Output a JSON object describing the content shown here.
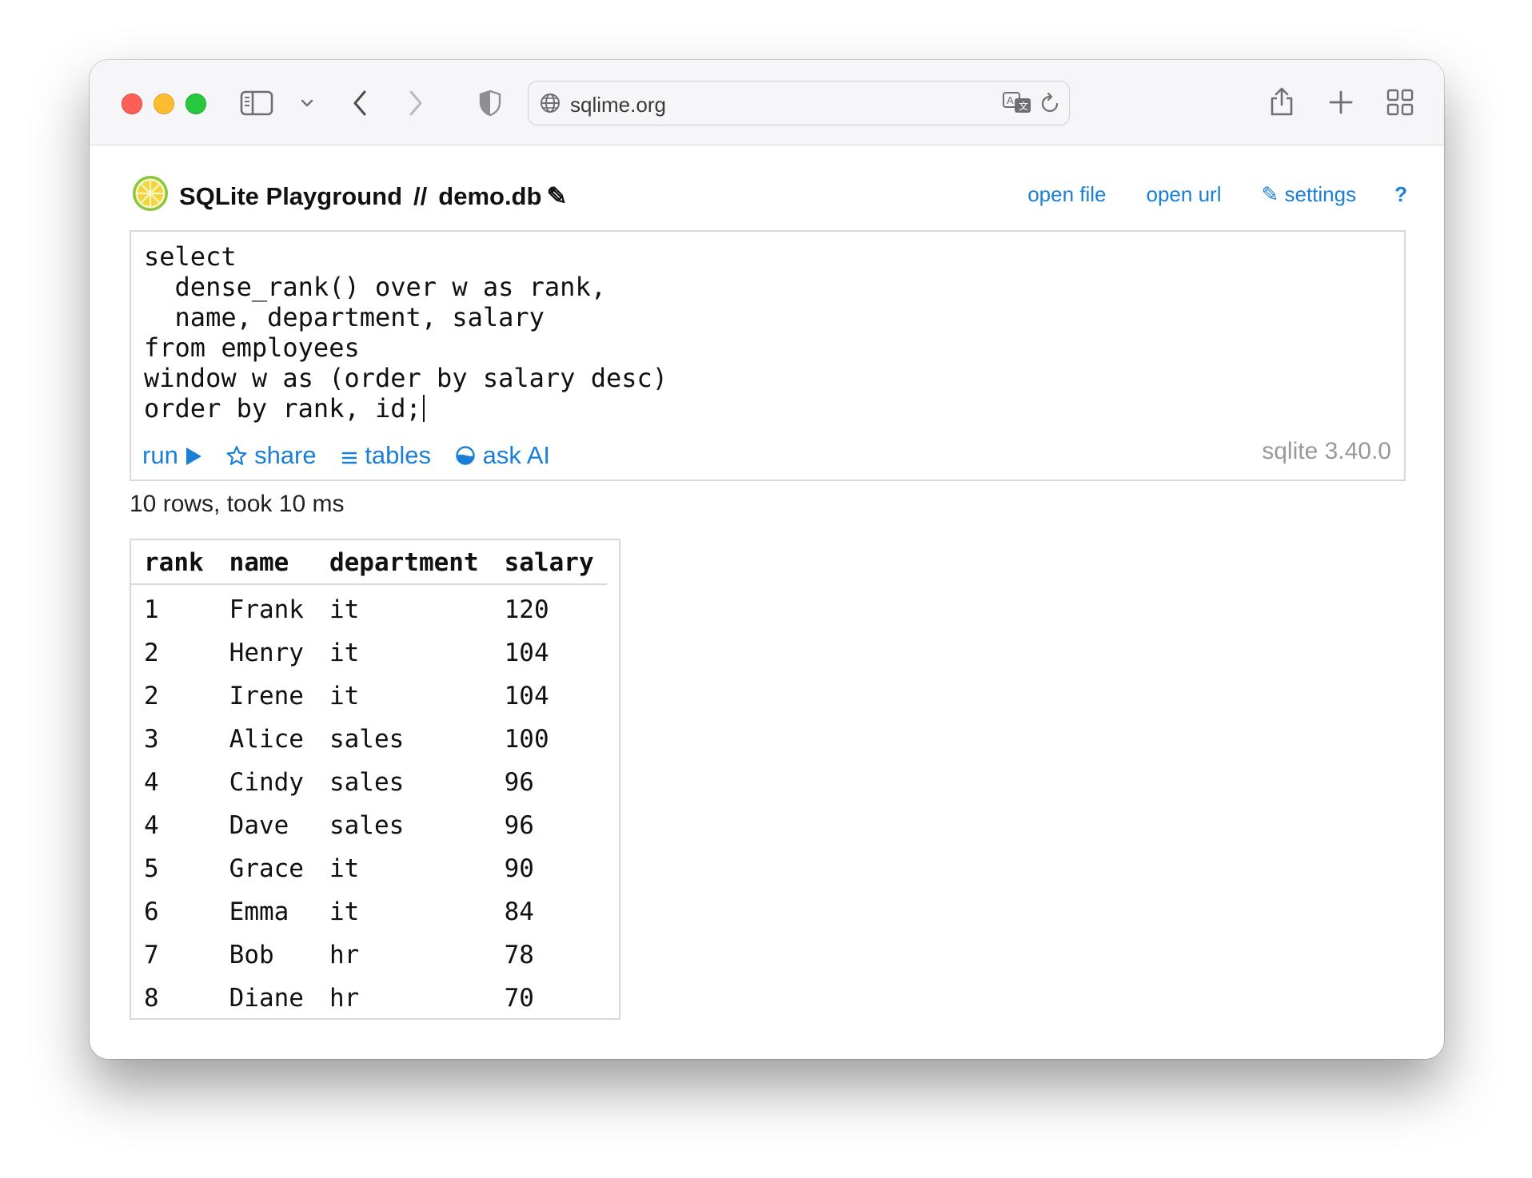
{
  "browser": {
    "url": "sqlime.org"
  },
  "app": {
    "title": "SQLite Playground",
    "separator": "//",
    "db_name": "demo.db",
    "db_edit_icon": "✎",
    "nav": {
      "open_file": "open file",
      "open_url": "open url",
      "settings": "✎ settings",
      "help": "?"
    }
  },
  "editor": {
    "code": "select\n  dense_rank() over w as rank,\n  name, department, salary\nfrom employees\nwindow w as (order by salary desc)\norder by rank, id;",
    "actions": {
      "run": "run",
      "share": "share",
      "tables": "tables",
      "ask_ai": "ask AI"
    },
    "version": "sqlite 3.40.0"
  },
  "result": {
    "status": "10 rows, took 10 ms",
    "columns": [
      "rank",
      "name",
      "department",
      "salary"
    ],
    "rows": [
      [
        "1",
        "Frank",
        "it",
        "120"
      ],
      [
        "2",
        "Henry",
        "it",
        "104"
      ],
      [
        "2",
        "Irene",
        "it",
        "104"
      ],
      [
        "3",
        "Alice",
        "sales",
        "100"
      ],
      [
        "4",
        "Cindy",
        "sales",
        "96"
      ],
      [
        "4",
        "Dave",
        "sales",
        "96"
      ],
      [
        "5",
        "Grace",
        "it",
        "90"
      ],
      [
        "6",
        "Emma",
        "it",
        "84"
      ],
      [
        "7",
        "Bob",
        "hr",
        "78"
      ],
      [
        "8",
        "Diane",
        "hr",
        "70"
      ]
    ]
  },
  "icons": {
    "sidebar": "sidebar-icon",
    "chevron_down": "chevron-down-icon",
    "back": "back-icon",
    "forward": "forward-icon",
    "shield": "shield-icon",
    "globe": "globe-icon",
    "translate": "translate-icon",
    "reload": "reload-icon",
    "share": "share-icon",
    "new_tab": "plus-icon",
    "tabs": "tab-overview-icon",
    "logo": "lime-logo-icon"
  },
  "colors": {
    "link": "#1a7fd6",
    "muted": "#999999"
  }
}
